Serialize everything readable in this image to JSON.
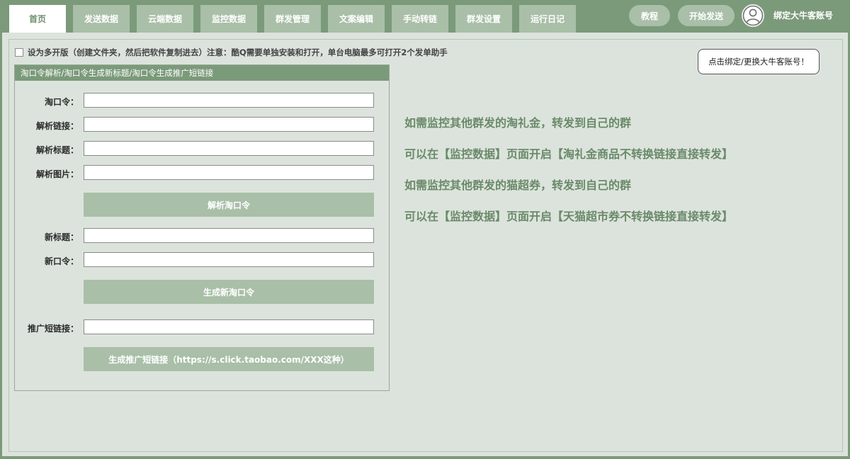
{
  "tabs": [
    {
      "label": "首页",
      "active": true
    },
    {
      "label": "发送数据",
      "active": false
    },
    {
      "label": "云端数据",
      "active": false
    },
    {
      "label": "监控数据",
      "active": false
    },
    {
      "label": "群发管理",
      "active": false
    },
    {
      "label": "文案编辑",
      "active": false
    },
    {
      "label": "手动转链",
      "active": false
    },
    {
      "label": "群发设置",
      "active": false
    },
    {
      "label": "运行日记",
      "active": false
    }
  ],
  "header": {
    "tutorial_label": "教程",
    "start_send_label": "开始发送",
    "account_label": "绑定大牛客账号",
    "avatar_icon": "user-icon"
  },
  "tooltip": {
    "text": "点击绑定/更换大牛客账号！"
  },
  "multi_instance": {
    "checked": false,
    "label": "设为多开版（创建文件夹，然后把软件复制进去）注意：酷Q需要单独安装和打开，单台电脑最多可打开2个发单助手"
  },
  "taokou_panel": {
    "title": "淘口令解析/淘口令生成新标题/淘口令生成推广短链接",
    "fields": {
      "taokouling": {
        "label": "淘口令：",
        "value": "",
        "placeholder": ""
      },
      "parse_link": {
        "label": "解析链接：",
        "value": "",
        "placeholder": ""
      },
      "parse_title": {
        "label": "解析标题：",
        "value": "",
        "placeholder": ""
      },
      "parse_image": {
        "label": "解析图片：",
        "value": "",
        "placeholder": ""
      },
      "new_title": {
        "label": "新标题：",
        "value": "",
        "placeholder": ""
      },
      "new_taokouling": {
        "label": "新口令：",
        "value": "",
        "placeholder": ""
      },
      "short_link": {
        "label": "推广短链接：",
        "value": "",
        "placeholder": ""
      }
    },
    "buttons": {
      "parse": "解析淘口令",
      "generate": "生成新淘口令",
      "short_link": "生成推广短链接（https://s.click.taobao.com/XXX这种）"
    }
  },
  "info_lines": [
    "如需监控其他群发的淘礼金，转发到自己的群",
    "可以在【监控数据】页面开启【淘礼金商品不转换链接直接转发】",
    "如需监控其他群发的猫超券，转发到自己的群",
    "可以在【监控数据】页面开启【天猫超市券不转换链接直接转发】"
  ],
  "colors": {
    "header_bg": "#7b9a7a",
    "tab_bg": "#a9bfa8",
    "panel_bg": "#dce3dc",
    "info_text": "#6a8a69"
  }
}
